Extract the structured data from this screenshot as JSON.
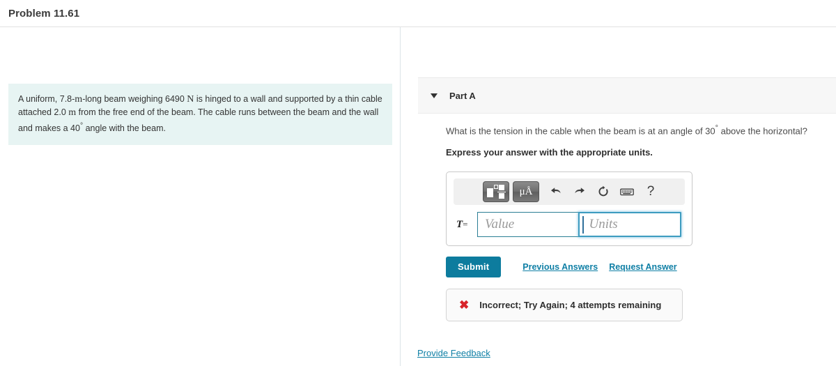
{
  "header": {
    "title": "Problem 11.61"
  },
  "problem": {
    "text_part1": "A uniform, 7.8-",
    "unit_m1": "m",
    "text_part2": "-long beam weighing 6490 ",
    "unit_N": "N",
    "text_part3": " is hinged to a wall and supported by a thin cable attached 2.0 ",
    "unit_m2": "m",
    "text_part4": " from the free end of the beam. The cable runs between the beam and the wall and makes a 40",
    "degree": "°",
    "text_part5": " angle with the beam."
  },
  "part": {
    "caret_icon": "caret-down-icon",
    "label": "Part A",
    "question_pre": "What is the tension in the cable when the beam is at an angle of 30",
    "question_degree": "°",
    "question_post": " above the horizontal?",
    "instruction": "Express your answer with the appropriate units."
  },
  "answer": {
    "toolbar": {
      "template_button": "math-template-icon",
      "units_button_label": "μÅ",
      "undo_icon": "undo-arrow-icon",
      "redo_icon": "redo-arrow-icon",
      "reset_icon": "reset-circular-arrow-icon",
      "keyboard_icon": "keyboard-icon",
      "help_label": "?"
    },
    "variable_label": "T",
    "equals_sign": "=",
    "value_placeholder": "Value",
    "units_placeholder": "Units"
  },
  "actions": {
    "submit_label": "Submit",
    "previous_answers_label": "Previous Answers",
    "request_answer_label": "Request Answer"
  },
  "feedback": {
    "status_icon": "red-x-icon",
    "status_symbol": "✖",
    "message": "Incorrect; Try Again; 4 attempts remaining"
  },
  "footer": {
    "provide_feedback_label": "Provide Feedback"
  },
  "colors": {
    "accent": "#0d7c9e",
    "link": "#0f7fa5",
    "problem_bg": "#e7f4f3",
    "error": "#d8232a",
    "focus_border": "#3d9cc0"
  }
}
